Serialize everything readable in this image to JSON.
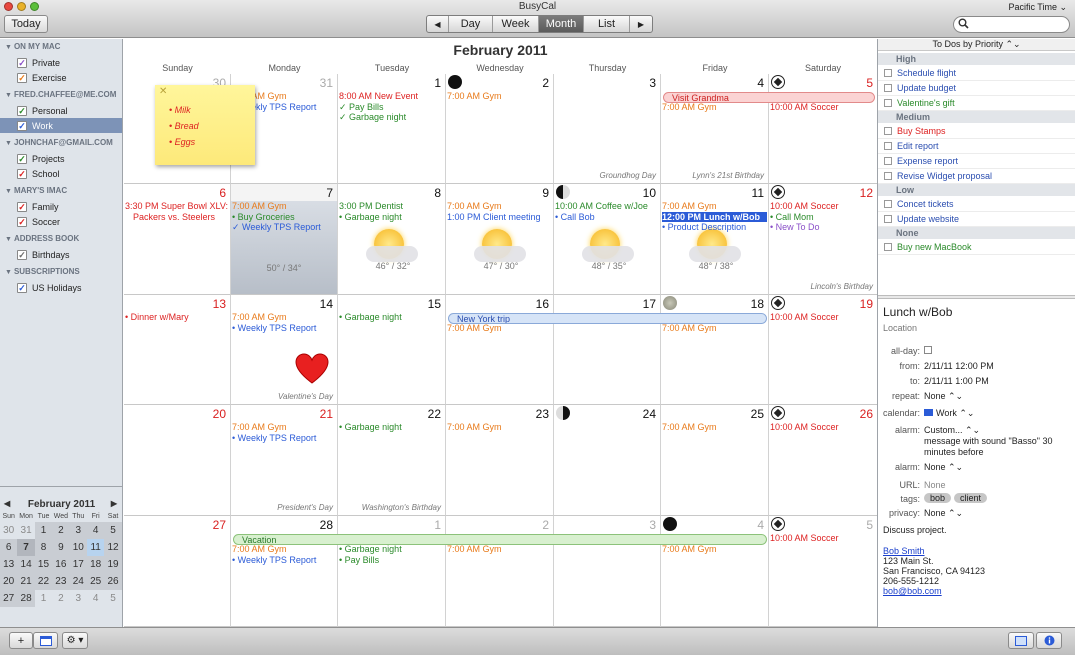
{
  "app": {
    "title": "BusyCal",
    "timezone": "Pacific Time ⌄",
    "today_label": "Today"
  },
  "views": {
    "prev": "◀",
    "day": "Day",
    "week": "Week",
    "month": "Month",
    "list": "List",
    "next": "▶",
    "selected": "Month"
  },
  "sidebar": {
    "groups": [
      {
        "label": "ON MY MAC",
        "calendars": [
          {
            "name": "Private",
            "color": "#8a4fc8"
          },
          {
            "name": "Exercise",
            "color": "#e87a1a"
          }
        ]
      },
      {
        "label": "FRED.CHAFFEE@ME.COM",
        "calendars": [
          {
            "name": "Personal",
            "color": "#2a8a2a"
          },
          {
            "name": "Work",
            "color": "#2b5bd7",
            "selected": true
          }
        ]
      },
      {
        "label": "JOHNCHAF@GMAIL.COM",
        "calendars": [
          {
            "name": "Projects",
            "color": "#2a8a2a"
          },
          {
            "name": "School",
            "color": "#d22"
          }
        ]
      },
      {
        "label": "MARY'S IMAC",
        "calendars": [
          {
            "name": "Family",
            "color": "#d22"
          },
          {
            "name": "Soccer",
            "color": "#d22"
          }
        ]
      },
      {
        "label": "ADDRESS BOOK",
        "calendars": [
          {
            "name": "Birthdays",
            "color": "#6b6b6b"
          }
        ]
      },
      {
        "label": "SUBSCRIPTIONS",
        "calendars": [
          {
            "name": "US Holidays",
            "color": "#2b5bd7"
          }
        ]
      }
    ]
  },
  "minical": {
    "title": "February 2011",
    "prev": "◀",
    "next": "▶",
    "weekdays": [
      "Sun",
      "Mon",
      "Tue",
      "Wed",
      "Thu",
      "Fri",
      "Sat"
    ],
    "weeks": [
      [
        "30",
        "31",
        "1",
        "2",
        "3",
        "4",
        "5"
      ],
      [
        "6",
        "7",
        "8",
        "9",
        "10",
        "11",
        "12"
      ],
      [
        "13",
        "14",
        "15",
        "16",
        "17",
        "18",
        "19"
      ],
      [
        "20",
        "21",
        "22",
        "23",
        "24",
        "25",
        "26"
      ],
      [
        "27",
        "28",
        "1",
        "2",
        "3",
        "4",
        "5"
      ]
    ]
  },
  "calendar": {
    "title": "February 2011",
    "weekdays": [
      "Sunday",
      "Monday",
      "Tuesday",
      "Wednesday",
      "Thursday",
      "Friday",
      "Saturday"
    ],
    "days": [
      {
        "num": "30",
        "other": true,
        "events": []
      },
      {
        "num": "31",
        "other": true,
        "events": [
          {
            "text": "7:00 AM Gym",
            "color": "#e87a1a"
          },
          {
            "text": "• Weekly TPS Report",
            "color": "#2b5bd7"
          }
        ]
      },
      {
        "num": "1",
        "events": [
          {
            "text": "8:00 AM New Event",
            "color": "#d22"
          },
          {
            "text": "✓ Pay Bills",
            "color": "#2a8a2a"
          },
          {
            "text": "✓ Garbage night",
            "color": "#2a8a2a"
          }
        ]
      },
      {
        "num": "2",
        "moon": "new",
        "events": [
          {
            "text": "7:00 AM Gym",
            "color": "#e87a1a"
          }
        ]
      },
      {
        "num": "3",
        "events": [],
        "holiday": "Groundhog Day"
      },
      {
        "num": "4",
        "events": [
          {
            "text": "",
            "color": "#fff"
          },
          {
            "text": "7:00 AM Gym",
            "color": "#e87a1a"
          }
        ],
        "holiday": "Lynn's 21st Birthday"
      },
      {
        "num": "5",
        "red": true,
        "ball": true,
        "events": [
          {
            "text": "",
            "color": "#fff"
          },
          {
            "text": "10:00 AM Soccer",
            "color": "#d22"
          }
        ]
      },
      {
        "num": "6",
        "red": true,
        "events": [
          {
            "text": "3:30 PM Super Bowl XLV:",
            "color": "#d22"
          },
          {
            "text": "Packers vs. Steelers",
            "color": "#d22",
            "indent": true
          }
        ]
      },
      {
        "num": "7",
        "today": true,
        "events": [
          {
            "text": "7:00 AM Gym",
            "color": "#e87a1a"
          },
          {
            "text": "• Buy Groceries",
            "color": "#2a8a2a"
          },
          {
            "text": "✓ Weekly TPS Report",
            "color": "#2b5bd7"
          }
        ],
        "weather": {
          "temp": "50° / 34°",
          "rain": true
        }
      },
      {
        "num": "8",
        "events": [
          {
            "text": "3:00 PM Dentist",
            "color": "#2a8a2a"
          },
          {
            "text": "• Garbage night",
            "color": "#2a8a2a"
          }
        ],
        "weather": {
          "temp": "46° / 32°"
        }
      },
      {
        "num": "9",
        "events": [
          {
            "text": "7:00 AM Gym",
            "color": "#e87a1a"
          },
          {
            "text": "1:00 PM Client meeting",
            "color": "#2b5bd7"
          }
        ],
        "weather": {
          "temp": "47° / 30°"
        }
      },
      {
        "num": "10",
        "moon": "first",
        "events": [
          {
            "text": "10:00 AM Coffee w/Joe",
            "color": "#2a8a2a"
          },
          {
            "text": "• Call Bob",
            "color": "#2b5bd7"
          }
        ],
        "weather": {
          "temp": "48° / 35°"
        }
      },
      {
        "num": "11",
        "events": [
          {
            "text": "7:00 AM Gym",
            "color": "#e87a1a"
          },
          {
            "text": "12:00 PM Lunch w/Bob",
            "color": "#fff",
            "selected": true
          },
          {
            "text": "• Product Description",
            "color": "#2b5bd7"
          }
        ],
        "weather": {
          "temp": "48° / 38°"
        }
      },
      {
        "num": "12",
        "red": true,
        "ball": true,
        "events": [
          {
            "text": "10:00 AM Soccer",
            "color": "#d22"
          },
          {
            "text": "• Call Mom",
            "color": "#2a8a2a"
          },
          {
            "text": "• New To Do",
            "color": "#8a4fc8"
          }
        ],
        "holiday": "Lincoln's Birthday"
      },
      {
        "num": "13",
        "red": true,
        "events": [
          {
            "text": "• Dinner w/Mary",
            "color": "#d22"
          }
        ]
      },
      {
        "num": "14",
        "events": [
          {
            "text": "7:00 AM Gym",
            "color": "#e87a1a"
          },
          {
            "text": "• Weekly TPS Report",
            "color": "#2b5bd7"
          }
        ],
        "heart": true,
        "holiday": "Valentine's Day"
      },
      {
        "num": "15",
        "events": [
          {
            "text": "• Garbage night",
            "color": "#2a8a2a"
          }
        ]
      },
      {
        "num": "16",
        "events": [
          {
            "text": "",
            "color": "#fff"
          },
          {
            "text": "7:00 AM Gym",
            "color": "#e87a1a"
          }
        ]
      },
      {
        "num": "17",
        "events": []
      },
      {
        "num": "18",
        "moon": "full",
        "events": [
          {
            "text": "",
            "color": "#fff"
          },
          {
            "text": "7:00 AM Gym",
            "color": "#e87a1a"
          }
        ]
      },
      {
        "num": "19",
        "red": true,
        "ball": true,
        "events": [
          {
            "text": "10:00 AM Soccer",
            "color": "#d22"
          }
        ]
      },
      {
        "num": "20",
        "red": true,
        "events": []
      },
      {
        "num": "21",
        "red": true,
        "events": [
          {
            "text": "7:00 AM Gym",
            "color": "#e87a1a"
          },
          {
            "text": "• Weekly TPS Report",
            "color": "#2b5bd7"
          }
        ],
        "holiday": "President's Day"
      },
      {
        "num": "22",
        "events": [
          {
            "text": "• Garbage night",
            "color": "#2a8a2a"
          }
        ],
        "holiday": "Washington's Birthday"
      },
      {
        "num": "23",
        "events": [
          {
            "text": "7:00 AM Gym",
            "color": "#e87a1a"
          }
        ]
      },
      {
        "num": "24",
        "moon": "last",
        "events": []
      },
      {
        "num": "25",
        "events": [
          {
            "text": "7:00 AM Gym",
            "color": "#e87a1a"
          }
        ]
      },
      {
        "num": "26",
        "red": true,
        "ball": true,
        "events": [
          {
            "text": "10:00 AM Soccer",
            "color": "#d22"
          }
        ]
      },
      {
        "num": "27",
        "red": true,
        "events": []
      },
      {
        "num": "28",
        "events": [
          {
            "text": "",
            "color": "#fff"
          },
          {
            "text": "7:00 AM Gym",
            "color": "#e87a1a"
          },
          {
            "text": "• Weekly TPS Report",
            "color": "#2b5bd7"
          }
        ]
      },
      {
        "num": "1",
        "other": true,
        "events": [
          {
            "text": "",
            "color": "#fff"
          },
          {
            "text": "• Garbage night",
            "color": "#2a8a2a"
          },
          {
            "text": "• Pay Bills",
            "color": "#2a8a2a"
          }
        ]
      },
      {
        "num": "2",
        "other": true,
        "events": [
          {
            "text": "",
            "color": "#fff"
          },
          {
            "text": "7:00 AM Gym",
            "color": "#e87a1a"
          }
        ]
      },
      {
        "num": "3",
        "other": true,
        "events": [
          {
            "text": "",
            "color": "#fff"
          }
        ]
      },
      {
        "num": "4",
        "other": true,
        "moon": "new",
        "events": [
          {
            "text": "",
            "color": "#fff"
          },
          {
            "text": "7:00 AM Gym",
            "color": "#e87a1a"
          }
        ]
      },
      {
        "num": "5",
        "other": true,
        "ball": true,
        "events": [
          {
            "text": "10:00 AM Soccer",
            "color": "#d22"
          }
        ]
      }
    ],
    "bars": [
      {
        "text": "Visit Grandma",
        "week": 0,
        "start": 5,
        "end": 6,
        "bg": "#fbd3d3",
        "border": "#e28a8a",
        "color": "#c22"
      },
      {
        "text": "New York trip",
        "week": 2,
        "start": 3,
        "end": 5,
        "bg": "#d6e4f7",
        "border": "#8aa9d9",
        "color": "#2b4eb0"
      },
      {
        "text": "Vacation",
        "week": 4,
        "start": 1,
        "end": 5,
        "bg": "#d8f0cf",
        "border": "#8cc27a",
        "color": "#2a7a2a"
      }
    ]
  },
  "sticky": {
    "close": "✕",
    "items": [
      "• Milk",
      "• Bread",
      "• Eggs"
    ]
  },
  "todos": {
    "header": "To Dos by Priority ⌃⌄",
    "groups": [
      {
        "label": "High",
        "items": [
          {
            "text": "Schedule flight",
            "color": "#2b4eb0"
          },
          {
            "text": "Update budget",
            "color": "#2b4eb0"
          },
          {
            "text": "Valentine's gift",
            "color": "#2a8a2a"
          }
        ]
      },
      {
        "label": "Medium",
        "items": [
          {
            "text": "Buy Stamps",
            "color": "#d22"
          },
          {
            "text": "Edit report",
            "color": "#2b4eb0"
          },
          {
            "text": "Expense report",
            "color": "#2b4eb0"
          },
          {
            "text": "Revise Widget proposal",
            "color": "#2b4eb0"
          }
        ]
      },
      {
        "label": "Low",
        "items": [
          {
            "text": "Concet tickets",
            "color": "#2b4eb0"
          },
          {
            "text": "Update website",
            "color": "#2b4eb0"
          }
        ]
      },
      {
        "label": "None",
        "items": [
          {
            "text": "Buy new MacBook",
            "color": "#2a8a2a"
          }
        ]
      }
    ]
  },
  "detail": {
    "title": "Lunch w/Bob",
    "location": "Location",
    "allday_label": "all-day:",
    "from_label": "from:",
    "from_value": "2/11/11    12:00 PM",
    "to_label": "to:",
    "to_value": "2/11/11    1:00 PM",
    "repeat_label": "repeat:",
    "repeat_value": "None ⌃⌄",
    "calendar_label": "calendar:",
    "calendar_value": "Work ⌃⌄",
    "calendar_color": "#2b5bd7",
    "alarm_label": "alarm:",
    "alarm_value": "Custom... ⌃⌄",
    "alarm_desc1": "message with sound \"Basso\" 30",
    "alarm_desc2": "minutes before",
    "alarm2_label": "alarm:",
    "alarm2_value": "None ⌃⌄",
    "url_label": "URL:",
    "url_value": "None",
    "tags_label": "tags:",
    "tags": [
      "bob",
      "client"
    ],
    "privacy_label": "privacy:",
    "privacy_value": "None ⌃⌄",
    "notes": "Discuss project.",
    "contact_name": "Bob Smith",
    "address1": "123 Main St.",
    "address2": "San Francisco, CA 94123",
    "phone": "206-555-1212",
    "email": "bob@bob.com"
  },
  "bottom": {
    "add": "+",
    "gear": "⚙︎ ▾"
  }
}
